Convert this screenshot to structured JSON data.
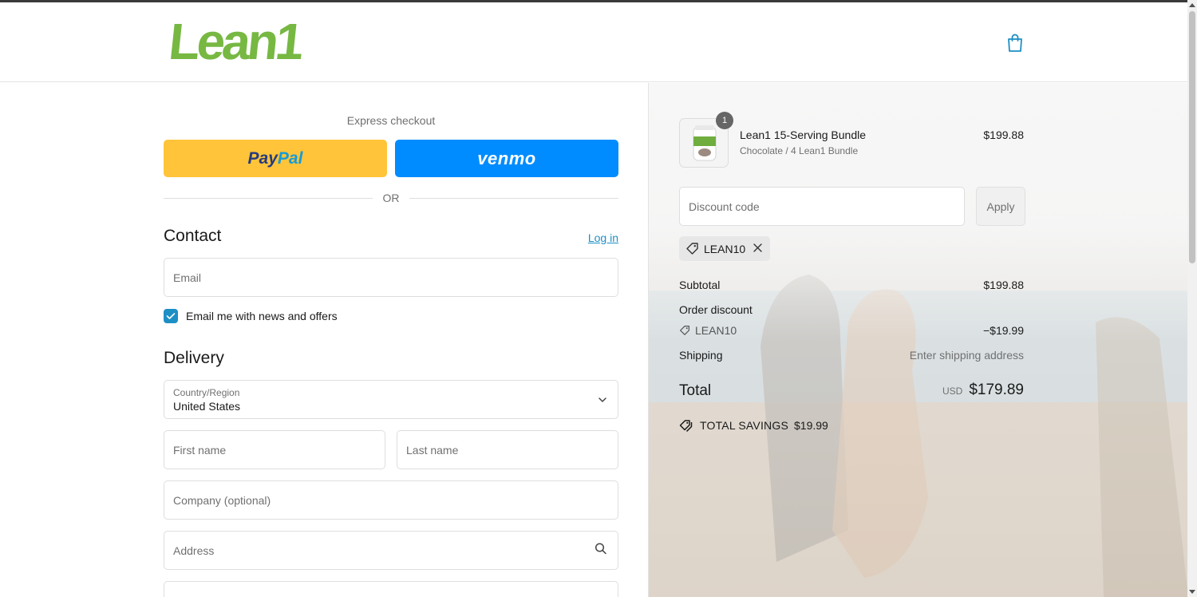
{
  "header": {
    "logo_text": "Lean1",
    "cart_icon": "shopping-bag-icon"
  },
  "express": {
    "label": "Express checkout",
    "paypal": {
      "pay": "Pay",
      "pal": "Pal"
    },
    "venmo": "venmo",
    "or_text": "OR"
  },
  "contact": {
    "title": "Contact",
    "login_link": "Log in",
    "email_placeholder": "Email",
    "newsletter_label": "Email me with news and offers",
    "newsletter_checked": true
  },
  "delivery": {
    "title": "Delivery",
    "country_label": "Country/Region",
    "country_value": "United States",
    "first_name_placeholder": "First name",
    "last_name_placeholder": "Last name",
    "company_placeholder": "Company (optional)",
    "address_placeholder": "Address"
  },
  "summary": {
    "product": {
      "quantity": "1",
      "name": "Lean1 15-Serving Bundle",
      "variant": "Chocolate / 4 Lean1 Bundle",
      "price": "$199.88"
    },
    "discount_placeholder": "Discount code",
    "apply_label": "Apply",
    "applied_code": "LEAN10",
    "subtotal_label": "Subtotal",
    "subtotal_value": "$199.88",
    "order_discount_label": "Order discount",
    "discount_code": "LEAN10",
    "discount_value": "−$19.99",
    "shipping_label": "Shipping",
    "shipping_value": "Enter shipping address",
    "total_label": "Total",
    "currency": "USD",
    "total_value": "$179.89",
    "savings_label": "TOTAL SAVINGS",
    "savings_value": "$19.99"
  },
  "colors": {
    "brand_green": "#77b843",
    "link_blue": "#1d8fc4",
    "paypal_yellow": "#ffc439",
    "venmo_blue": "#008cff"
  }
}
